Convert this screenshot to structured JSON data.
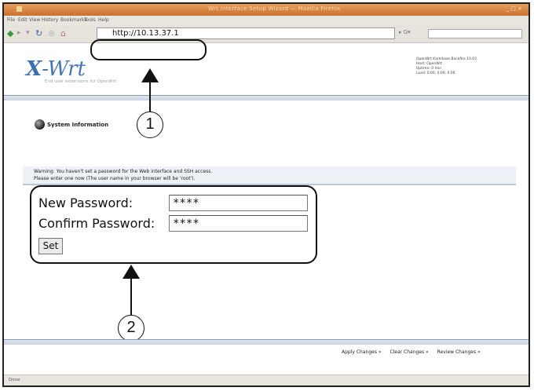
{
  "browser": {
    "window_title": "Wrt Interface Setup Wizard — Mozilla Firefox",
    "window_controls": "_ □ ×",
    "menu": [
      "File",
      "Edit",
      "View",
      "History",
      "Bookmarks",
      "Tools",
      "Help"
    ],
    "url": "http://10.13.37.1",
    "status_text": "Done"
  },
  "header": {
    "logo_x": "X",
    "logo_rest": "-Wrt",
    "tagline": "End user extensions for OpenWrt",
    "host_info": [
      "OpenWrt Kamikaze Backfire 10.03",
      "Host: OpenWrt",
      "Uptime: 0 min",
      "Load: 0.00, 0.00, 0.00"
    ]
  },
  "page": {
    "section_title": "System Information",
    "warning_line1": "Warning: You haven't set a password for the Web interface and SSH access.",
    "warning_line2": "Please enter one now (The user name in your browser will be 'root')."
  },
  "form": {
    "new_password_label": "New Password:",
    "new_password_value": "****",
    "confirm_password_label": "Confirm Password:",
    "confirm_password_value": "****",
    "set_button": "Set"
  },
  "footer": {
    "apply": "Apply Changes »",
    "clear": "Clear Changes »",
    "review": "Review Changes »"
  },
  "callouts": {
    "one": "1",
    "two": "2"
  }
}
